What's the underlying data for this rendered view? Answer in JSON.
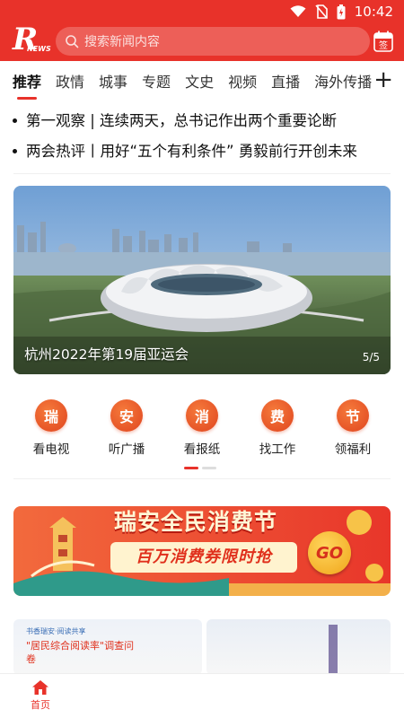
{
  "status": {
    "time": "10:42"
  },
  "header": {
    "logo_letter": "R",
    "logo_sub": "NEWS",
    "search_placeholder": "搜索新闻内容",
    "calendar_label": "签"
  },
  "tabs": [
    {
      "label": "推荐",
      "active": true
    },
    {
      "label": "政情"
    },
    {
      "label": "城事"
    },
    {
      "label": "专题"
    },
    {
      "label": "文史"
    },
    {
      "label": "视频"
    },
    {
      "label": "直播"
    },
    {
      "label": "海外传播"
    }
  ],
  "tab_more": "+",
  "headlines": [
    "第一观察 | 连续两天，总书记作出两个重要论断",
    "两会热评丨用好“五个有利条件” 勇毅前行开创未来"
  ],
  "banner": {
    "caption": "杭州2022年第19届亚运会",
    "counter": "5/5"
  },
  "services": [
    {
      "icon_char": "瑞",
      "label": "看电视"
    },
    {
      "icon_char": "安",
      "label": "听广播"
    },
    {
      "icon_char": "消",
      "label": "看报纸"
    },
    {
      "icon_char": "费",
      "label": "找工作"
    },
    {
      "icon_char": "节",
      "label": "领福利"
    }
  ],
  "promo": {
    "title": "瑞安全民消费节",
    "subtitle": "百万消费券限时抢",
    "go": "GO"
  },
  "reading": {
    "small": "书香瑞安·阅读共享",
    "title": "\"居民综合阅读率\"调查问卷"
  },
  "bottom_nav": {
    "home": "首页"
  },
  "colors": {
    "brand": "#e8322a",
    "service": "#e8501f"
  }
}
